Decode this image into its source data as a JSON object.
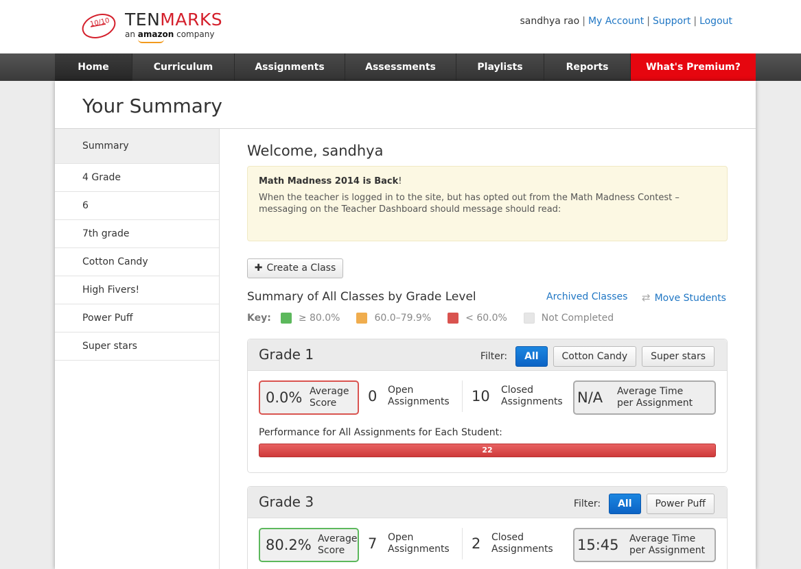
{
  "header": {
    "logo": {
      "brand_prefix": "TEN",
      "brand_suffix": "MARKS",
      "badge": "10/10",
      "tag_pre": "an",
      "tag_brand": "amazon",
      "tag_post": "company"
    },
    "user": {
      "name": "sandhya rao",
      "separator": "|",
      "links": [
        "My Account",
        "Support",
        "Logout"
      ]
    }
  },
  "nav": {
    "items": [
      "Home",
      "Curriculum",
      "Assignments",
      "Assessments",
      "Playlists",
      "Reports",
      "What's Premium?"
    ],
    "active": "Home"
  },
  "page": {
    "title": "Your Summary"
  },
  "sidebar": {
    "items": [
      "Summary",
      "4 Grade",
      "6",
      "7th grade",
      "Cotton Candy",
      "High Fivers!",
      "Power Puff",
      "Super stars"
    ],
    "active": "Summary"
  },
  "main": {
    "welcome": "Welcome, sandhya",
    "notice": {
      "title": "Math Madness 2014 is Back",
      "title_suffix": "!",
      "body": "When the teacher is logged in to the site, but has opted out from the Math Madness Contest – messaging on the Teacher Dashboard should message should read:"
    },
    "create_class": {
      "icon": "plus-icon",
      "label": "Create a Class"
    },
    "summary_heading": "Summary of All Classes by Grade Level",
    "archived_link": "Archived Classes",
    "move_students": {
      "icon": "swap-arrows-icon",
      "label": "Move Students"
    },
    "key": {
      "label": "Key:",
      "items": [
        {
          "label": "≥ 80.0%",
          "color": "#5cb85c"
        },
        {
          "label": "60.0–79.9%",
          "color": "#f0ad4e"
        },
        {
          "label": "< 60.0%",
          "color": "#d9534f"
        },
        {
          "label": "Not Completed",
          "color": "#e6e6e6"
        }
      ]
    },
    "grades": [
      {
        "name": "Grade 1",
        "filter_label": "Filter:",
        "filters": [
          "All",
          "Cotton Candy",
          "Super stars"
        ],
        "active_filter": "All",
        "average_score": "0.0%",
        "average_score_label": [
          "Average",
          "Score"
        ],
        "score_color": "#d9534f",
        "open_count": "0",
        "open_label": [
          "Open",
          "Assignments"
        ],
        "closed_count": "10",
        "closed_label": [
          "Closed",
          "Assignments"
        ],
        "avg_time": "N/A",
        "avg_time_label": [
          "Average Time",
          "per Assignment"
        ],
        "performance_label": "Performance for All Assignments for Each Student:",
        "performance_bar": {
          "value": "22",
          "color": "#d9534f",
          "fraction": 1.0
        }
      },
      {
        "name": "Grade 3",
        "filter_label": "Filter:",
        "filters": [
          "All",
          "Power Puff"
        ],
        "active_filter": "All",
        "average_score": "80.2%",
        "average_score_label": [
          "Average",
          "Score"
        ],
        "score_color": "#5cb85c",
        "open_count": "7",
        "open_label": [
          "Open",
          "Assignments"
        ],
        "closed_count": "2",
        "closed_label": [
          "Closed",
          "Assignments"
        ],
        "avg_time": "15:45",
        "avg_time_label": [
          "Average Time",
          "per Assignment"
        ]
      }
    ]
  }
}
